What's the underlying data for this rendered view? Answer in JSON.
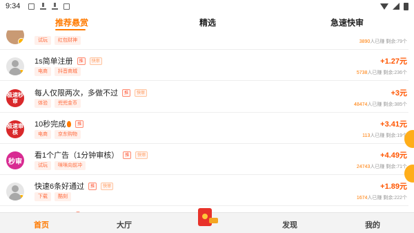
{
  "status_bar": {
    "time": "9:34"
  },
  "tabs": [
    {
      "label": "推荐悬赏",
      "active": true
    },
    {
      "label": "精选",
      "active": false
    },
    {
      "label": "急速快审",
      "active": false
    }
  ],
  "tasks": [
    {
      "title": "",
      "tags": [
        "试玩",
        "红包财神"
      ],
      "price": "",
      "count": "3890",
      "count_label": "人已赚",
      "remaining": "剩余:79个"
    },
    {
      "title": "1s简单注册",
      "marks": [
        "推",
        "快审"
      ],
      "tags": [
        "电商",
        "抖音商城"
      ],
      "price": "+1.27元",
      "count": "5738",
      "count_label": "人已赚",
      "remaining": "剩余:236个"
    },
    {
      "title": "每人仅限两次，多做不过",
      "marks": [
        "推",
        "快审"
      ],
      "tags": [
        "体验",
        "兜兜金币"
      ],
      "price": "+3元",
      "count": "48474",
      "count_label": "人已赚",
      "remaining": "剩余:385个",
      "avatar_text": "极速秒审"
    },
    {
      "title": "10秒完成",
      "marks": [
        "推"
      ],
      "tags": [
        "电商",
        "京东购物"
      ],
      "price": "+3.41元",
      "count": "113",
      "count_label": "人已赚",
      "remaining": "剩余:19个",
      "avatar_text": "极速审核"
    },
    {
      "title": "看1个广告（1分钟审核）",
      "marks": [
        "推",
        "快审"
      ],
      "tags": [
        "试玩",
        "咪咪向前冲"
      ],
      "price": "+4.49元",
      "count": "24743",
      "count_label": "人已赚",
      "remaining": "剩余:71个",
      "avatar_text": "秒审"
    },
    {
      "title": "快速6条好通过",
      "marks": [
        "推",
        "快审"
      ],
      "tags": [
        "下载",
        "酷刻"
      ],
      "price": "+1.89元",
      "count": "1674",
      "count_label": "人已赚",
      "remaining": "剩余:222个"
    }
  ],
  "bottom_nav": [
    {
      "label": "首页",
      "active": true
    },
    {
      "label": "大厅",
      "active": false
    },
    {
      "label": "发现",
      "active": false
    },
    {
      "label": "我的",
      "active": false
    }
  ],
  "colors": {
    "accent": "#ff7a00",
    "price": "#ff5500"
  }
}
